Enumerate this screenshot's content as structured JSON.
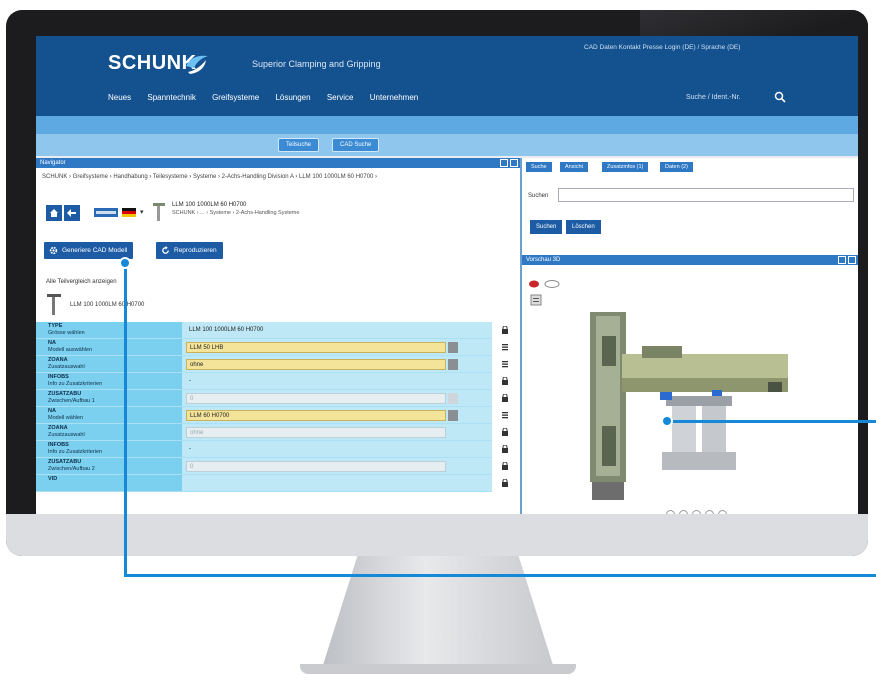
{
  "header": {
    "brand": "SCHUNK",
    "tagline": "Superior Clamping and Gripping",
    "top_links": "CAD Daten    Kontakt    Presse    Login (DE) / Sprache (DE)",
    "nav_items": [
      "Neues",
      "Spanntechnik",
      "Greifsysteme",
      "Lösungen",
      "Service",
      "Unternehmen"
    ],
    "search_placeholder": "Suche / Ident.-Nr."
  },
  "subnav": {
    "buttons": [
      "Teilsuche",
      "CAD Suche"
    ]
  },
  "left_panel": {
    "title": "Navigator",
    "breadcrumb": "SCHUNK  ›  Greifsysteme  ›  Handhabung  ›  Teilesysteme  ›  Systeme  ›  2-Achs-Handling Division A  ›  LLM 100 1000LM 60 H0700  ›",
    "product_name": "LLM 100 1000LM 60 H0700",
    "product_path": "SCHUNK  ›  ...  ›  Systeme  ›  2-Achs-Handling Systeme",
    "generate_cad_button": "Generiere CAD Modell",
    "reproduce_button": "Reproduzieren",
    "show_parts_link": "Alle Teilvergleich anzeigen",
    "part_label": "LLM 100 1000LM 60 H0700",
    "rows": [
      {
        "key": "TYPE",
        "sub": "Grösse wählen",
        "value": "LLM 100 1000LM 60 H0700",
        "style": "plain",
        "lock": true
      },
      {
        "key": "NA",
        "sub": "Modell auswählen",
        "value": "LLM 50 LHB",
        "style": "yellow",
        "lock": false
      },
      {
        "key": "ZOANA",
        "sub": "Zusatzauswahl",
        "value": "ohne",
        "style": "yellow",
        "lock": false
      },
      {
        "key": "INFOBS",
        "sub": "Info zu Zusatzkriterien",
        "value": "-",
        "style": "plain",
        "lock": true
      },
      {
        "key": "ZUSATZABU",
        "sub": "Zwischen/Aufbau 1",
        "value": "0",
        "style": "grey",
        "lock": true
      },
      {
        "key": "NA",
        "sub": "Modell wählen",
        "value": "LLM 60 H0700",
        "style": "yellow",
        "lock": false
      },
      {
        "key": "ZOANA",
        "sub": "Zusatzauswahl",
        "value": "ohne",
        "style": "grey",
        "lock": true
      },
      {
        "key": "INFOBS",
        "sub": "Info zu Zusatzkriterien",
        "value": "-",
        "style": "plain",
        "lock": true
      },
      {
        "key": "ZUSATZABU",
        "sub": "Zwischen/Aufbau 2",
        "value": "0",
        "style": "grey",
        "lock": true
      },
      {
        "key": "VID",
        "sub": "",
        "value": "",
        "style": "plain",
        "lock": true
      }
    ]
  },
  "right_panel": {
    "tabs": [
      "Suche",
      "Ansicht",
      "Zusatzinfos (1)",
      "Daten (2)"
    ],
    "search_label": "Suchen",
    "search_button": "Suchen",
    "reset_button": "Löschen",
    "viewer_title": "Vorschau 3D"
  },
  "colors": {
    "brand_blue": "#14528f",
    "accent": "#1588d8",
    "table_key": "#7cd0ef",
    "table_value": "#bfe8f7",
    "field_highlight": "#f4e49a"
  }
}
